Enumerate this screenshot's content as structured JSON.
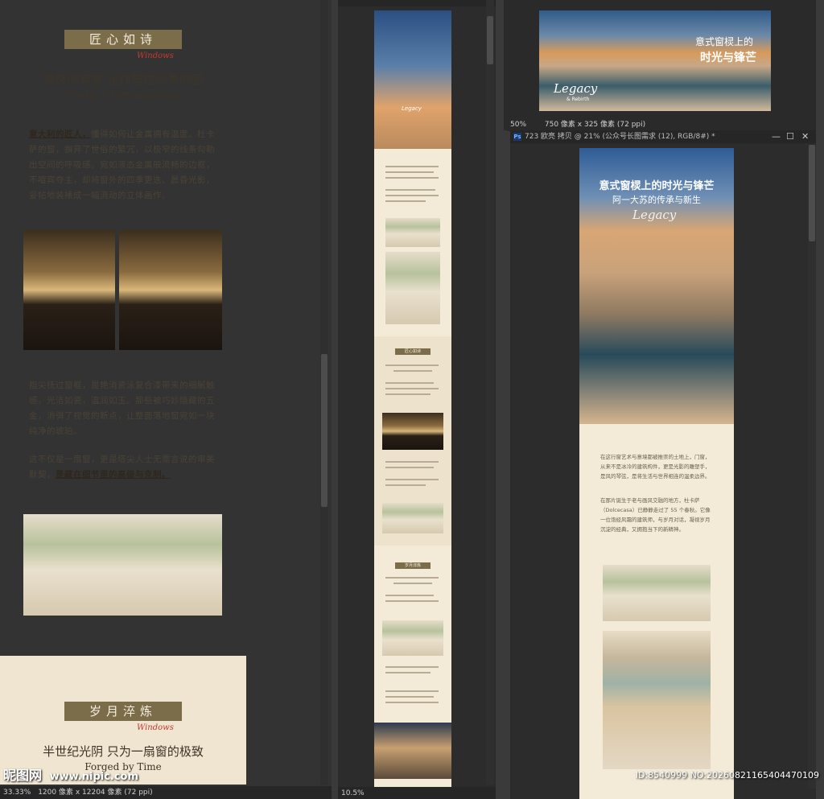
{
  "left_doc": {
    "badge1": "匠心如诗",
    "script1": "Windows",
    "heading1": "将极简美学 化作框住风景的画",
    "subheading1": "Poetic Craftsmanship",
    "para1_lead": "意大利的匠人，",
    "para1_rest": "懂得如何让金属拥有温度。杜卡萨的窗，摒弃了世俗的繁冗，以极窄的线条勾勒出空间的呼吸感。宛如液态金属般流畅的边框，不喧宾夺主，却将窗外的四季更迭、晨昏光影，妥帖地装裱成一幅流动的立体画作。",
    "para2": "指尖抚过窗框，是艳消瓷泳复合漆带来的细腻触感，光洁如瓷，温润如玉。那些被巧妙隐藏的五金，消弭了视觉的断点，让整面落地窗宛如一块纯净的琥珀。",
    "para3_start": "这不仅是一扇窗，更是塔尖人士无需言说的审美默契，",
    "para3_bold": "是藏在细节里的高级与克制。",
    "badge2": "岁月淬炼",
    "script2": "Windows",
    "heading2": "半世纪光阴 只为一扇窗的极致",
    "subheading2": "Forged by Time"
  },
  "status": {
    "left_zoom": "33.33%",
    "left_info": "1200 像素 x 12204 像素 (72 ppi)",
    "middle_zoom": "10.5%",
    "top_right_zoom": "50%",
    "top_right_info": "750 像素 x 325 像素 (72 ppi)"
  },
  "top_right": {
    "title_line1": "意式窗棂上的",
    "title_line2": "时光与锋芒",
    "logo": "Legacy",
    "logo_sub": "& Rebirth"
  },
  "bottom_right": {
    "window_title": "723 欧亮 拷贝 @ 21% (公众号长图需求 (12), RGB/8#) *",
    "title": "意式窗棂上的时光与锋芒",
    "subtitle": "阿一大苏的传承与新生",
    "logo": "Legacy",
    "caption": "在这行窗艺术与意境都被推崇的土地上，门窗，从来不是冰冷的建筑构件，更是光影的雕塑手，是风的琴弦，是将生活与世界相连的温柔边界。",
    "para2": "在那片诞生于老与画风交融的地方，杜卡萨（Dolcecasa）已静静走过了 55 个春秋。它像一位饱经风霜的建筑师，与岁月对话，凝视岁月沉淀的经典，又拥抱当下的新精神。"
  },
  "middle": {
    "badge1": "匠心如诗",
    "badge2": "岁月淬炼",
    "logo": "Legacy"
  },
  "watermark": {
    "site_cn": "昵图网",
    "site_url": "www.nipic.com",
    "id_text": "ID:8540999 NO:20260821165404470109"
  },
  "icons": {
    "photoshop": "Ps",
    "minimize": "—",
    "maximize": "☐",
    "close": "✕"
  }
}
